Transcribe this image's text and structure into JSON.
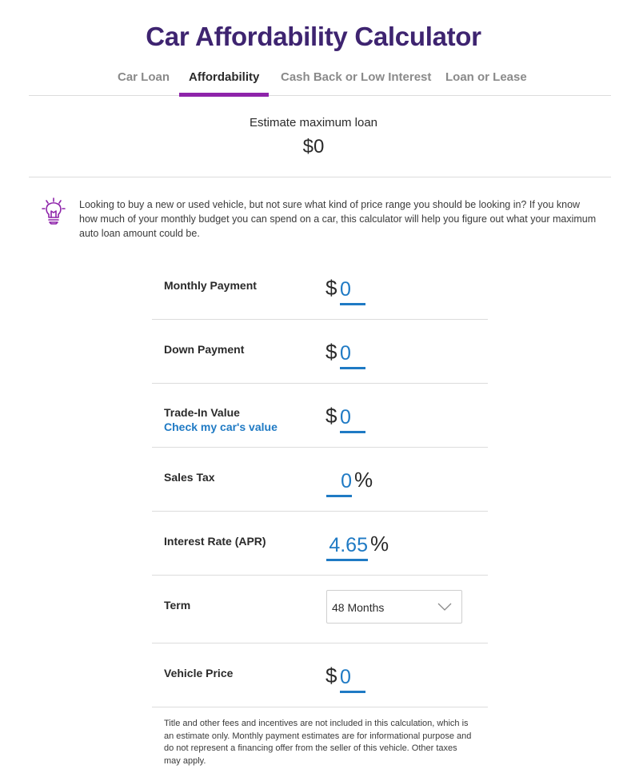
{
  "header": {
    "title": "Car Affordability Calculator"
  },
  "tabs": [
    {
      "label": "Car Loan",
      "active": false
    },
    {
      "label": "Affordability",
      "active": true
    },
    {
      "label": "Cash Back or Low Interest",
      "active": false
    },
    {
      "label": "Loan or Lease",
      "active": false
    }
  ],
  "summary": {
    "label": "Estimate maximum loan",
    "value": "$0"
  },
  "tip": {
    "icon": "lightbulb-icon",
    "text": "Looking to buy a new or used vehicle, but not sure what kind of price range you should be looking in? If you know how much of your monthly budget you can spend on a car, this calculator will help you figure out what your maximum auto loan amount could be."
  },
  "form": {
    "monthly_payment": {
      "label": "Monthly Payment",
      "prefix": "$",
      "value": "0"
    },
    "down_payment": {
      "label": "Down Payment",
      "prefix": "$",
      "value": "0"
    },
    "trade_in": {
      "label": "Trade-In Value",
      "link": "Check my car's value",
      "prefix": "$",
      "value": "0"
    },
    "sales_tax": {
      "label": "Sales Tax",
      "value": "0",
      "suffix": "%"
    },
    "interest_rate": {
      "label": "Interest Rate (APR)",
      "value": "4.65",
      "suffix": "%"
    },
    "term": {
      "label": "Term",
      "selected": "48 Months"
    },
    "vehicle_price": {
      "label": "Vehicle Price",
      "prefix": "$",
      "value": "0"
    }
  },
  "disclaimer": "Title and other fees and incentives are not included in this calculation, which is an estimate only. Monthly payment estimates are for informational purpose and do not represent a financing offer from the seller of this vehicle. Other taxes may apply.",
  "colors": {
    "title": "#3e2470",
    "tab_accent": "#8e24aa",
    "input_blue": "#1f7ac4",
    "icon_purple": "#8e24aa"
  }
}
